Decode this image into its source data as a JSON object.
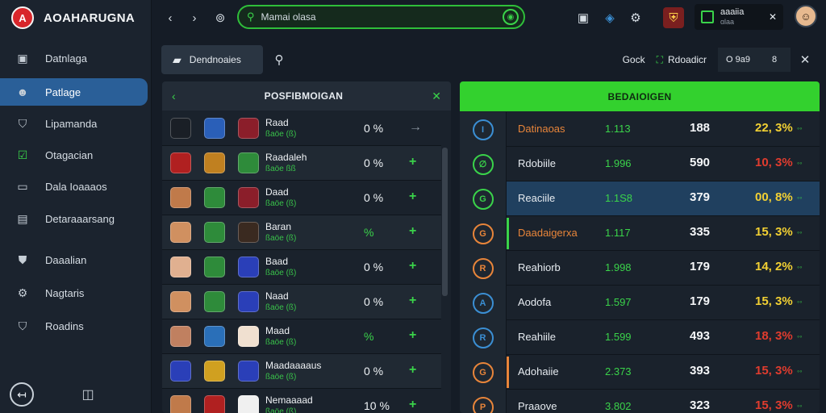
{
  "app": {
    "name": "AOAHARUGNA",
    "logo_text": "A"
  },
  "sidebar": {
    "items": [
      {
        "label": "Datnlaga",
        "icon": "dashboard-icon"
      },
      {
        "label": "Patlage",
        "icon": "player-icon",
        "active": true
      },
      {
        "label": "Lipamanda",
        "icon": "shield-icon"
      },
      {
        "label": "Otagacian",
        "icon": "checkbox-icon"
      },
      {
        "label": "Dala Ioaaaos",
        "icon": "card-icon"
      },
      {
        "label": "Detaraaarsang",
        "icon": "document-icon"
      },
      {
        "label": "Daaalian",
        "icon": "shield-icon"
      },
      {
        "label": "Nagtaris",
        "icon": "gear-icon"
      },
      {
        "label": "Roadins",
        "icon": "shield-icon"
      }
    ]
  },
  "topbar": {
    "search_value": "Mamai olasa",
    "user_label": "aaaiia",
    "user_sub": "ɑlaa"
  },
  "subbar": {
    "dashboard_label": "Dendnoaies",
    "label1": "Gock",
    "label2": "Rdoadicr",
    "chip": "O 9a9",
    "chip2": "8"
  },
  "left_panel": {
    "title": "POSFIBMOIGAN",
    "rows": [
      {
        "name": "Raad",
        "sub": "ßaöe (ß)",
        "pct": "0 %",
        "action": "→"
      },
      {
        "name": "Raadaleh",
        "sub": "ßaöe ßß",
        "pct": "0 %",
        "action": "+"
      },
      {
        "name": "Daad",
        "sub": "ßaöe (ß)",
        "pct": "0 %",
        "action": "+"
      },
      {
        "name": "Baran",
        "sub": "ßaöe (ß)",
        "pct": "%",
        "action": "+"
      },
      {
        "name": "Baad",
        "sub": "ßaöe (ß)",
        "pct": "0 %",
        "action": "+"
      },
      {
        "name": "Naad",
        "sub": "ßaöe (ß)",
        "pct": "0 %",
        "action": "+"
      },
      {
        "name": "Maad",
        "sub": "ßaöe (ß)",
        "pct": "%",
        "action": "+"
      },
      {
        "name": "Maadaaaaus",
        "sub": "ßaöe (ß)",
        "pct": "0 %",
        "action": "+"
      },
      {
        "name": "Nemaaaad",
        "sub": "ßaöe (ß)",
        "pct": "10 %",
        "action": "+"
      }
    ]
  },
  "right_panel": {
    "title": "BEDAIOIGEN",
    "rows": [
      {
        "name": "Datinaoas",
        "v1": "1.113",
        "v2": "188",
        "v3": "22, 3%",
        "name_color": "#e8853a",
        "v3_color": "#f2d033",
        "icon_color": "#3b8fd4",
        "icon": "I"
      },
      {
        "name": "Rdobiile",
        "v1": "1.996",
        "v2": "590",
        "v3": "10, 3%",
        "name_color": "#e6ebf0",
        "v3_color": "#e03c2e",
        "icon_color": "#3ad34a",
        "icon": "∅"
      },
      {
        "name": "Reaciile",
        "v1": "1.1S8",
        "v2": "379",
        "v3": "00, 8%",
        "name_color": "#e6ebf0",
        "v3_color": "#f2d033",
        "icon_color": "#3ad34a",
        "icon": "G"
      },
      {
        "name": "Daadaigerxa",
        "v1": "1.117",
        "v2": "335",
        "v3": "15, 3%",
        "name_color": "#e8853a",
        "v3_color": "#f2d033",
        "icon_color": "#e8853a",
        "icon": "G"
      },
      {
        "name": "Reahiorb",
        "v1": "1.998",
        "v2": "179",
        "v3": "14, 2%",
        "name_color": "#e6ebf0",
        "v3_color": "#f2d033",
        "icon_color": "#e8853a",
        "icon": "R"
      },
      {
        "name": "Aodofa",
        "v1": "1.597",
        "v2": "179",
        "v3": "15, 3%",
        "name_color": "#e6ebf0",
        "v3_color": "#f2d033",
        "icon_color": "#3b8fd4",
        "icon": "A"
      },
      {
        "name": "Reahiile",
        "v1": "1.599",
        "v2": "493",
        "v3": "18, 3%",
        "name_color": "#e6ebf0",
        "v3_color": "#e03c2e",
        "icon_color": "#3b8fd4",
        "icon": "R"
      },
      {
        "name": "Adohaiie",
        "v1": "2.373",
        "v2": "393",
        "v3": "15, 3%",
        "name_color": "#e6ebf0",
        "v3_color": "#e03c2e",
        "icon_color": "#e8853a",
        "icon": "G"
      },
      {
        "name": "Praaove",
        "v1": "3.802",
        "v2": "323",
        "v3": "15, 3%",
        "name_color": "#e6ebf0",
        "v3_color": "#e03c2e",
        "icon_color": "#e8853a",
        "icon": "P"
      }
    ]
  }
}
